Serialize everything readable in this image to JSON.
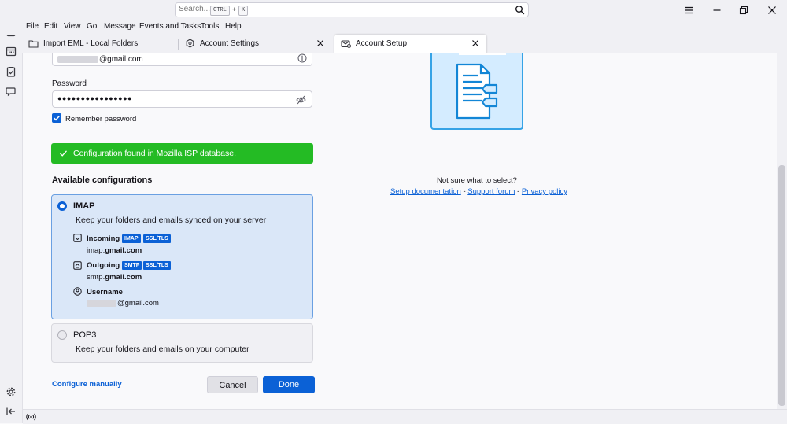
{
  "search": {
    "placeholder": "Search...",
    "kbd_ctrl": "CTRL",
    "kbd_plus": "+",
    "kbd_k": "K"
  },
  "menu": [
    "File",
    "Edit",
    "View",
    "Go",
    "Message",
    "Events and Tasks",
    "Tools",
    "Help"
  ],
  "tabs": [
    {
      "label": "Import EML - Local Folders",
      "icon": "folder-icon"
    },
    {
      "label": "Account Settings",
      "icon": "gear-icon"
    },
    {
      "label": "Account Setup",
      "icon": "envelope-icon"
    }
  ],
  "form": {
    "email_value": "@gmail.com",
    "password_label": "Password",
    "password_value": "●●●●●●●●●●●●●●●●",
    "remember_label": "Remember password",
    "remember_checked": true
  },
  "banner": {
    "text": "Configuration found in Mozilla ISP database.",
    "color": "#24bb24"
  },
  "configs": {
    "title": "Available configurations",
    "imap": {
      "name": "IMAP",
      "desc": "Keep your folders and emails synced on your server",
      "incoming_label": "Incoming",
      "incoming_badges": [
        "IMAP",
        "SSL/TLS"
      ],
      "incoming_host_pre": "imap.",
      "incoming_host_bold": "gmail.com",
      "outgoing_label": "Outgoing",
      "outgoing_badges": [
        "SMTP",
        "SSL/TLS"
      ],
      "outgoing_host_pre": "smtp.",
      "outgoing_host_bold": "gmail.com",
      "username_label": "Username",
      "username_value": "@gmail.com"
    },
    "pop3": {
      "name": "POP3",
      "desc": "Keep your folders and emails on your computer"
    }
  },
  "actions": {
    "configure_manually": "Configure manually",
    "cancel": "Cancel",
    "done": "Done"
  },
  "help": {
    "question": "Not sure what to select?",
    "setup_doc": "Setup documentation",
    "sep": "-",
    "support_forum": "Support forum",
    "privacy_policy": "Privacy policy"
  },
  "colors": {
    "accent": "#0b61d6",
    "success": "#24bb24"
  }
}
